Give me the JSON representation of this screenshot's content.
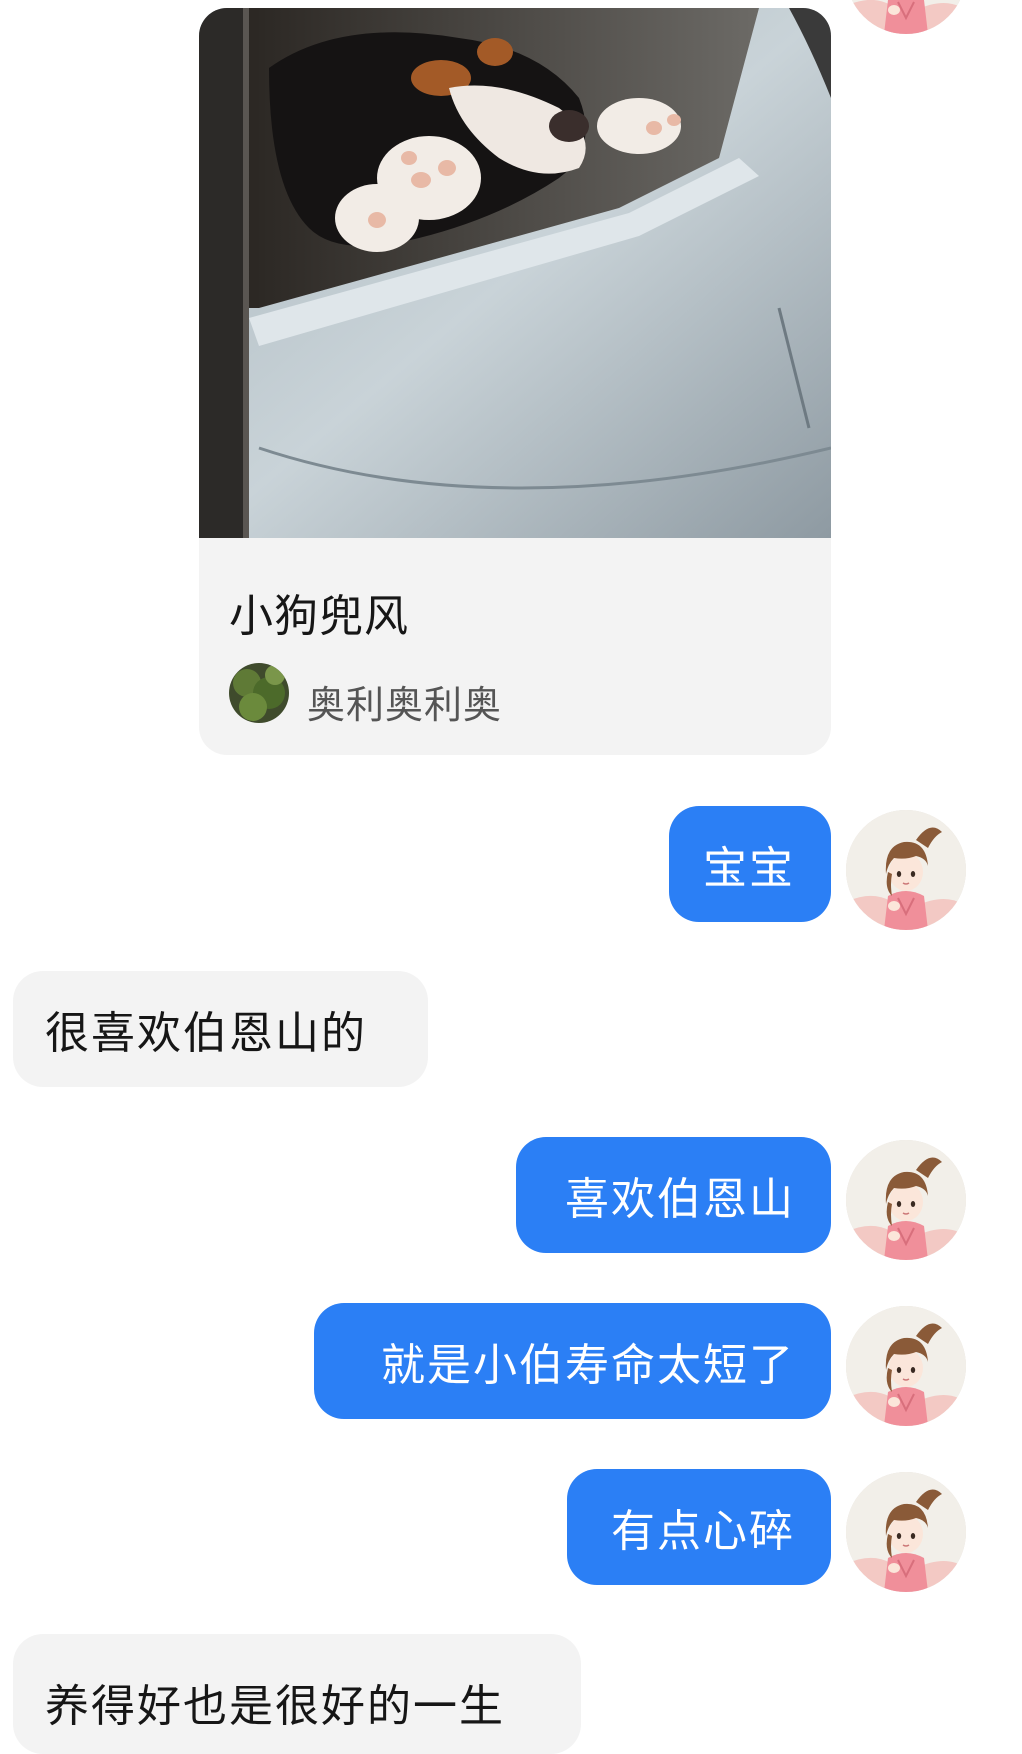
{
  "shared_card": {
    "title": "小狗兜风",
    "author": "奥利奥利奥",
    "image_icon": "dog-in-car-photo",
    "author_avatar_icon": "foliage-avatar"
  },
  "self_avatar_icon": "anime-girl-avatar",
  "colors": {
    "self_bubble": "#2b7ff5",
    "other_bubble": "#f3f3f3",
    "self_text": "#ffffff",
    "other_text": "#161616"
  },
  "messages": [
    {
      "from": "me",
      "text": "宝宝"
    },
    {
      "from": "them",
      "text": "很喜欢伯恩山的"
    },
    {
      "from": "me",
      "text": "喜欢伯恩山"
    },
    {
      "from": "me",
      "text": "就是小伯寿命太短了"
    },
    {
      "from": "me",
      "text": "有点心碎"
    },
    {
      "from": "them",
      "text": "养得好也是很好的一生"
    }
  ]
}
